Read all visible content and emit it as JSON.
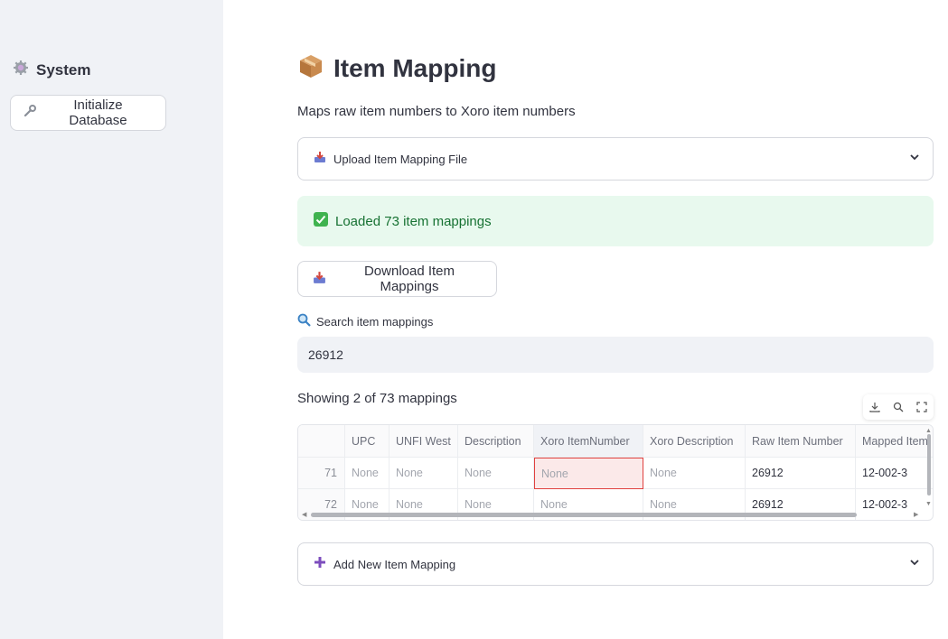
{
  "sidebar": {
    "section_title": "System",
    "init_button": "Initialize Database"
  },
  "page": {
    "title": "Item Mapping",
    "subtitle": "Maps raw item numbers to Xoro item numbers",
    "upload_expander": "Upload Item Mapping File",
    "success_message": "Loaded 73 item mappings",
    "download_button": "Download Item Mappings",
    "search_label": "Search item mappings",
    "search_value": "26912",
    "showing_text": "Showing 2 of 73 mappings",
    "add_expander": "Add New Item Mapping"
  },
  "table": {
    "columns": [
      "UPC",
      "UNFI West",
      "Description",
      "Xoro ItemNumber",
      "Xoro Description",
      "Raw Item Number",
      "Mapped Item"
    ],
    "rows": [
      {
        "index": "71",
        "cells": [
          "None",
          "None",
          "None",
          "None",
          "None",
          "26912",
          "12-002-3"
        ]
      },
      {
        "index": "72",
        "cells": [
          "None",
          "None",
          "None",
          "None",
          "None",
          "26912",
          "12-002-3"
        ]
      }
    ]
  },
  "colors": {
    "sidebar_bg": "#f0f2f6",
    "success_bg": "#e8f9ee",
    "success_text": "#177233",
    "selected_cell_border": "#e0413f"
  }
}
